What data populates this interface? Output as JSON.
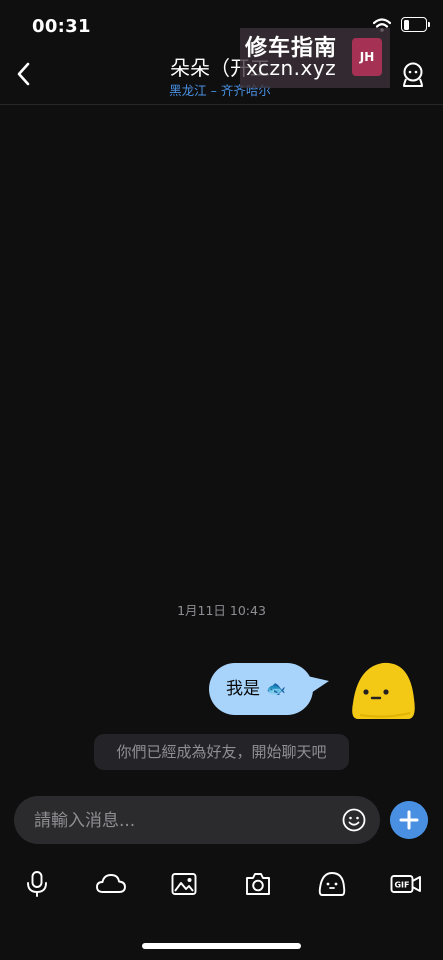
{
  "status_bar": {
    "time": "00:31"
  },
  "header": {
    "title": "朵朵（开工",
    "location": "黑龙江 – 齐齐哈尔"
  },
  "watermark": {
    "title": "修车指南",
    "url": "xczn.xyz",
    "logo_text": "JH"
  },
  "chat": {
    "timestamp": "1月11日 10:43",
    "messages": [
      {
        "text": "我是",
        "emoji": "🐟",
        "side": "right"
      }
    ],
    "system_notice": "你們已經成為好友，開始聊天吧"
  },
  "input": {
    "placeholder": "請輸入消息..."
  },
  "toolbar": {
    "icons": [
      "microphone-icon",
      "cloud-icon",
      "image-icon",
      "camera-icon",
      "sticker-icon",
      "gif-video-icon"
    ],
    "gif_label": "GIF"
  },
  "colors": {
    "accent": "#4a90e2",
    "bubble": "#a8d4fb",
    "background": "#0f0f10",
    "avatar_yellow": "#f4c916"
  }
}
